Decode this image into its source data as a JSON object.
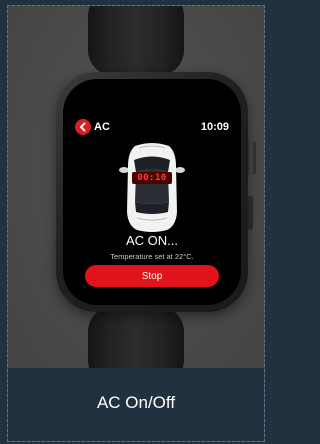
{
  "watch_screen": {
    "app_title": "AC",
    "time": "10:09",
    "temperature_readout": "00:10",
    "status": "AC ON...",
    "detail": "Temperature set at 22°C.",
    "stop_label": "Stop",
    "back_icon": "chevron-left-icon",
    "accent_color": "#e1141b"
  },
  "caption": "AC On/Off"
}
